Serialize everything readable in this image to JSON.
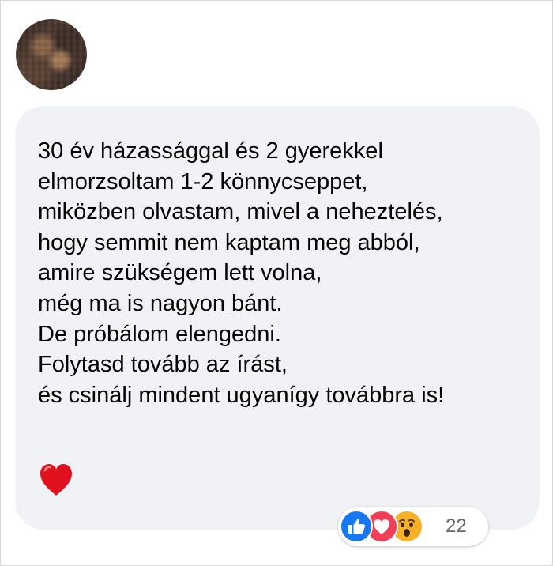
{
  "comment": {
    "lines": [
      "30 év házassággal és 2 gyerekkel",
      "elmorzsoltam 1-2 könnycseppet,",
      "miközben olvastam, mivel a neheztelés,",
      "hogy semmit nem kaptam meg abból,",
      "amire szükségem lett volna,",
      "még ma is nagyon bánt.",
      "De próbálom elengedni.",
      "Folytasd tovább az írást,",
      "és csinálj mindent ugyanígy továbbra is!"
    ],
    "emoji": "heart-icon"
  },
  "reactions": {
    "icons": [
      "like-icon",
      "love-icon",
      "wow-icon"
    ],
    "count": "22"
  },
  "colors": {
    "bubble": "#f0f2f5",
    "text": "#050505",
    "like": "#1877f2",
    "love": "#f33e58",
    "wow": "#f7b125",
    "count": "#65676b"
  }
}
